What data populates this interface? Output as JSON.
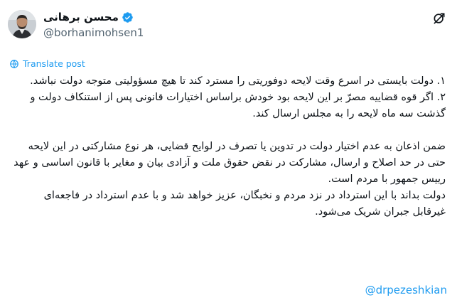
{
  "author": {
    "display_name": "محسن برهانی",
    "handle": "@borhanimohsen1",
    "verified": true
  },
  "icons": {
    "verified": "verified-badge-icon",
    "grok": "grok-icon",
    "translate": "translate-icon"
  },
  "translate_label": "Translate post",
  "body": {
    "p1": "۱. دولت بایستی در اسرع وقت لایحه دوفوریتی را مسترد کند تا هیچ مسؤولیتی متوجه دولت نباشد.",
    "p2": "۲. اگر قوه قضاییه مصرّ بر این لایحه بود خودش براساس اختیارات قانونی پس از استنکاف دولت و گذشت سه ماه لایحه را به مجلس ارسال کند.",
    "p3": "ضمن اذعان به عدم اختیار دولت در تدوین یا تصرف در لوایح قضایی، هر نوع مشارکتی در این لایحه حتی در حد اصلاح و ارسال، مشارکت در نقض حقوق ملت و آزادی بیان و مغایر با قانون اساسی و عهد رییس جمهور با مردم است.",
    "p4": "دولت بداند با این استرداد در نزد مردم و نخبگان، عزیز خواهد شد و با عدم استرداد در فاجعه‌ای غیرقابل جبران شریک می‌شود."
  },
  "mention": "@drpezeshkian",
  "colors": {
    "link": "#1d9bf0",
    "text": "#0f1419",
    "muted": "#536471"
  }
}
